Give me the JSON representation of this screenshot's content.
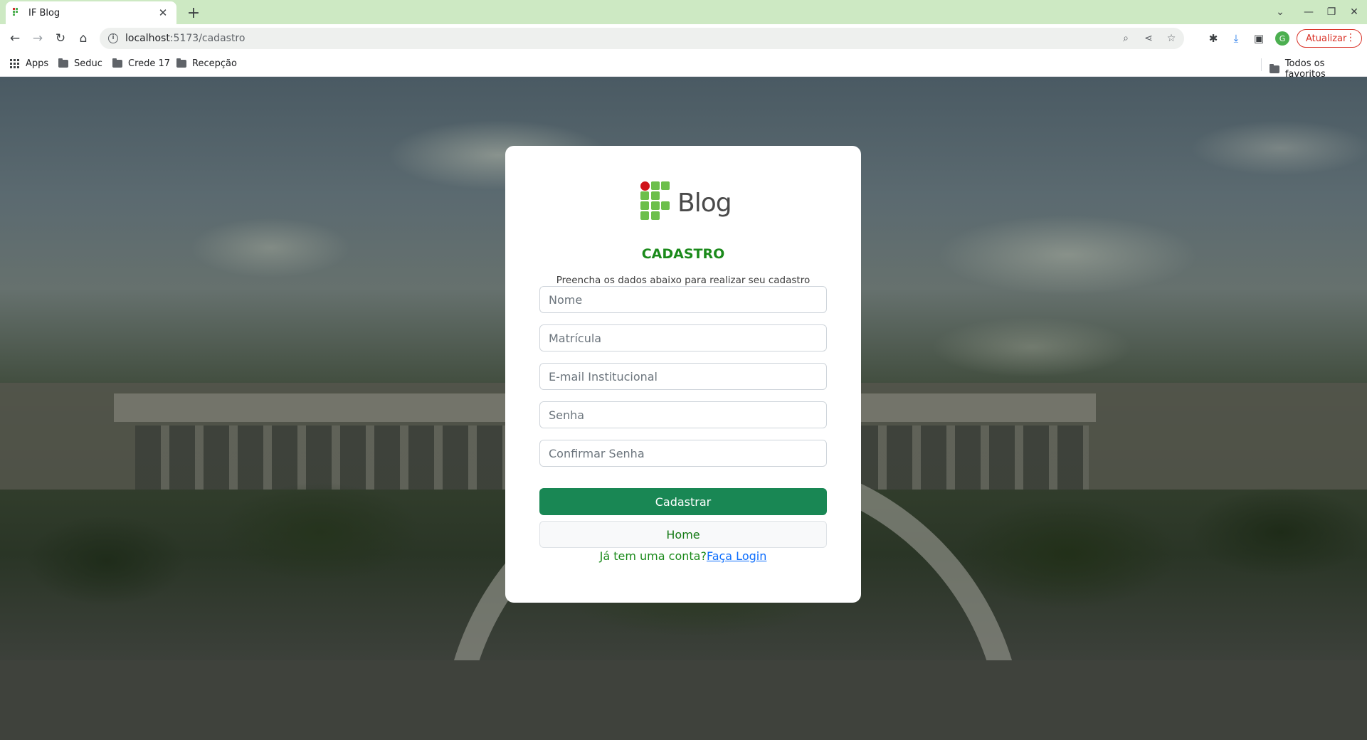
{
  "browser": {
    "tab_title": "IF Blog",
    "tab_close": "✕",
    "new_tab": "+",
    "url_host": "localhost",
    "url_path": ":5173/cadastro",
    "update_label": "Atualizar",
    "avatar_letter": "G"
  },
  "bookmarks": {
    "apps": "Apps",
    "items": [
      "Seduc",
      "Crede 17",
      "Recepção"
    ],
    "all_favorites": "Todos os favoritos"
  },
  "card": {
    "logo_text": "Blog",
    "title": "CADASTRO",
    "subtitle": "Preencha os dados abaixo para realizar seu cadastro",
    "fields": {
      "name": "Nome",
      "registration": "Matrícula",
      "email": "E-mail Institucional",
      "password": "Senha",
      "confirm_password": "Confirmar Senha"
    },
    "submit_label": "Cadastrar",
    "home_label": "Home",
    "have_account": "Já tem uma conta?",
    "login_link": "Faça Login"
  },
  "colors": {
    "accent_green": "#198754",
    "title_green": "#1b8a1b",
    "link_blue": "#0d6efd",
    "tabstrip": "#cde9c3",
    "update_red": "#d93025"
  }
}
